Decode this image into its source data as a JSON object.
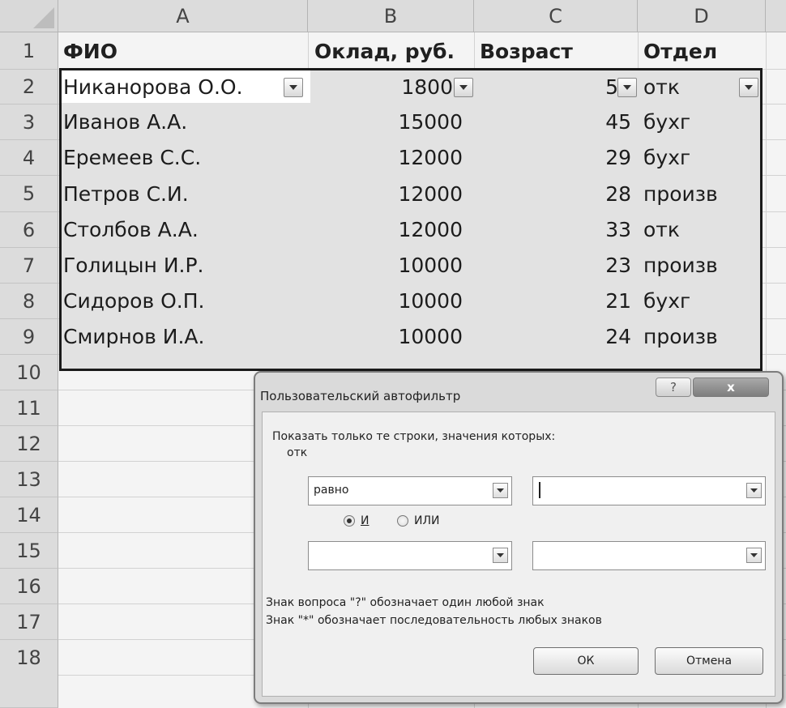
{
  "sheet": {
    "columns": [
      "A",
      "B",
      "C",
      "D"
    ],
    "rows": [
      "1",
      "2",
      "3",
      "4",
      "5",
      "6",
      "7",
      "8",
      "9",
      "10",
      "11",
      "12",
      "13",
      "14",
      "15",
      "16",
      "17",
      "18"
    ],
    "header": {
      "fio": "ФИО",
      "salary": "Оклад, руб.",
      "age": "Возраст",
      "dept": "Отдел"
    },
    "data": [
      {
        "fio": "Никанорова О.О.",
        "salary": "1800",
        "age": "5",
        "dept": "отк"
      },
      {
        "fio": "Иванов А.А.",
        "salary": "15000",
        "age": "45",
        "dept": "бухг"
      },
      {
        "fio": "Еремеев С.С.",
        "salary": "12000",
        "age": "29",
        "dept": "бухг"
      },
      {
        "fio": "Петров С.И.",
        "salary": "12000",
        "age": "28",
        "dept": "произв"
      },
      {
        "fio": "Столбов А.А.",
        "salary": "12000",
        "age": "33",
        "dept": "отк"
      },
      {
        "fio": "Голицын И.Р.",
        "salary": "10000",
        "age": "23",
        "dept": "произв"
      },
      {
        "fio": "Сидоров О.П.",
        "salary": "10000",
        "age": "21",
        "dept": "бухг"
      },
      {
        "fio": "Смирнов И.А.",
        "salary": "10000",
        "age": "24",
        "dept": "произв"
      }
    ]
  },
  "dialog": {
    "title": "Пользовательский автофильтр",
    "help": "?",
    "close": "x",
    "prompt": "Показать только те строки, значения которых:",
    "field": "отк",
    "condition1": {
      "operator": "равно",
      "value": ""
    },
    "logic": {
      "and": "И",
      "or": "ИЛИ",
      "selected": "and"
    },
    "condition2": {
      "operator": "",
      "value": ""
    },
    "hint1": "Знак вопроса \"?\" обозначает один любой знак",
    "hint2": "Знак \"*\" обозначает последовательность любых знаков",
    "ok": "ОК",
    "cancel": "Отмена"
  },
  "icons": {
    "filter": "dropdown-arrow-icon",
    "help": "question-icon",
    "close": "close-icon"
  }
}
